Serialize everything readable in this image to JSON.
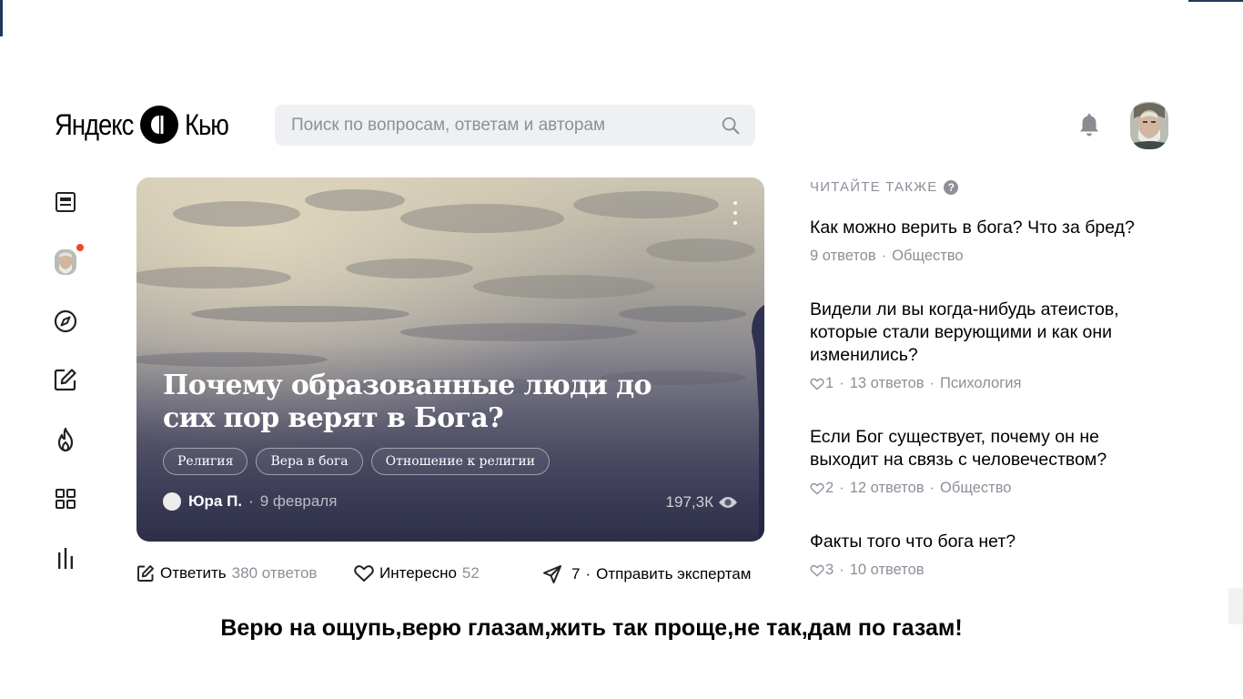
{
  "header": {
    "logo_left": "Яндекс",
    "logo_right": "Кью",
    "search_placeholder": "Поиск по вопросам, ответам и авторам"
  },
  "card": {
    "title": "Почему образованные люди до сих пор верят в Бога?",
    "tags": [
      "Религия",
      "Вера в бога",
      "Отношение к религии"
    ],
    "author": "Юра П.",
    "separator": "·",
    "date": "9 февраля",
    "views": "197,3К"
  },
  "actions": {
    "answer_label": "Ответить",
    "answers_count": "380 ответов",
    "interesting_label": "Интересно",
    "interesting_count": "52",
    "send_count": "7",
    "send_sep": "·",
    "send_label": "Отправить экспертам"
  },
  "related": {
    "heading": "Читайте также",
    "help": "?",
    "items": [
      {
        "title": "Как можно верить в бога? Что за бред?",
        "likes": "",
        "answers": "9 ответов",
        "topic": "Общество"
      },
      {
        "title": "Видели ли вы когда-нибудь атеистов, которые стали верующими и как они изменились?",
        "likes": "1",
        "answers": "13 ответов",
        "topic": "Психология"
      },
      {
        "title": "Если Бог существует, почему он не выходит на связь с человечеством?",
        "likes": "2",
        "answers": "12 ответов",
        "topic": "Общество"
      },
      {
        "title": "Факты того что бога нет?",
        "likes": "3",
        "answers": "10 ответов",
        "topic": ""
      }
    ],
    "dot": "·"
  },
  "caption": "Верю на ощупь,верю глазам,жить так проще,не так,дам по газам!",
  "colors": {
    "accent_dot": "#f2442f",
    "muted_text": "#8d8f99",
    "search_bg": "#eff0f3"
  },
  "icons": {
    "sidebar": [
      "feed-icon",
      "profile-avatar",
      "compass-icon",
      "edit-icon",
      "fire-icon",
      "apps-grid-icon",
      "stats-icon"
    ],
    "header": [
      "search-icon",
      "bell-icon",
      "user-avatar"
    ]
  }
}
